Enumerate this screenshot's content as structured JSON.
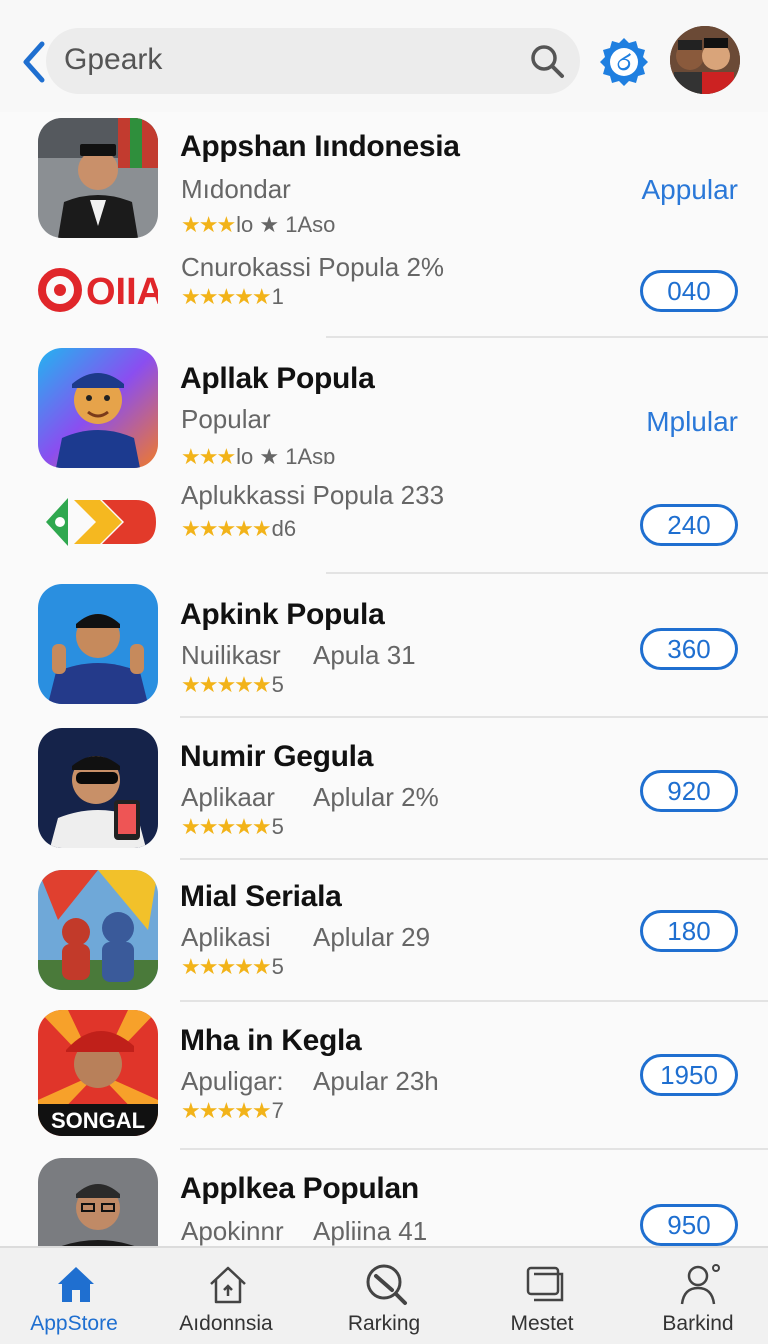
{
  "search": {
    "query": "Gpeark"
  },
  "colors": {
    "accent": "#1f6fd0",
    "star": "#f2b319"
  },
  "apps": [
    {
      "title": "Appshan Iındonesia",
      "subtitle": "Mıdondar",
      "stars_text": "★★★",
      "rating_tail": "lo ★ 1Aso",
      "action_label": "Appular",
      "extra": {
        "subtitle": "Cnurokassi Popula 2%",
        "stars_text": "★★★★★",
        "rating_tail": "1",
        "button": "040",
        "logo": "OIIA"
      }
    },
    {
      "title": "Apllak Popula",
      "subtitle": "Popular",
      "stars_text": "★★★",
      "rating_tail": "lo ★ 1Asɒ",
      "action_label": "Mplular",
      "extra": {
        "subtitle": "Aplukkassi Popula 233",
        "stars_text": "★★★★★",
        "rating_tail": "d6",
        "button": "240"
      }
    },
    {
      "title": "Apkink Popula",
      "subtitle": "Nuilikasr",
      "subtitle2": "Apula 31",
      "stars_text": "★★★★★",
      "rating_tail": "5",
      "button": "360"
    },
    {
      "title": "Numir Gegula",
      "subtitle": "Aplikaar",
      "subtitle2": "Aplular 2%",
      "stars_text": "★★★★★",
      "rating_tail": "5",
      "button": "920"
    },
    {
      "title": "Mial Seriala",
      "subtitle": "Aplikasi",
      "subtitle2": "Aplular 29",
      "stars_text": "★★★★★",
      "rating_tail": "5",
      "button": "180"
    },
    {
      "title": "Mha in Kegla",
      "subtitle": "Apuligar:",
      "subtitle2": "Apular 23h",
      "stars_text": "★★★★★",
      "rating_tail": "7",
      "button": "1950",
      "icon_text": "SONGAL"
    },
    {
      "title": "Applkea Populan",
      "subtitle": "Apokinnr",
      "subtitle2": "Apliina 41",
      "stars_text": "★★★★★",
      "rating_tail": "",
      "button": "950"
    }
  ],
  "nav": [
    {
      "label": "AppStore",
      "icon": "home-icon",
      "active": true
    },
    {
      "label": "Aıdonnsia",
      "icon": "house-icon"
    },
    {
      "label": "Rarking",
      "icon": "ranking-icon"
    },
    {
      "label": "Mestet",
      "icon": "messages-icon"
    },
    {
      "label": "Barkind",
      "icon": "profile-icon"
    }
  ]
}
